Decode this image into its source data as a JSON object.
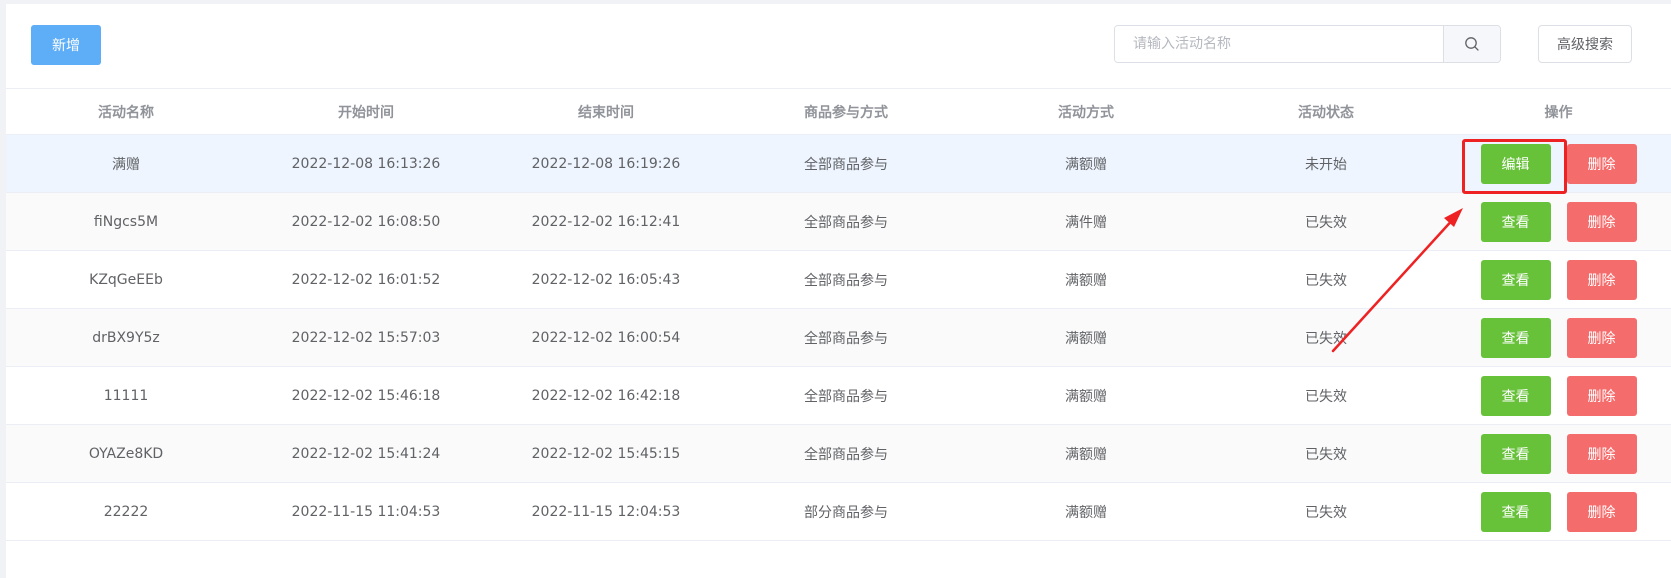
{
  "toolbar": {
    "add_label": "新增",
    "search_placeholder": "请输入活动名称",
    "search_value": "",
    "advanced_label": "高级搜索"
  },
  "table": {
    "columns": [
      "活动名称",
      "开始时间",
      "结束时间",
      "商品参与方式",
      "活动方式",
      "活动状态",
      "操作"
    ],
    "rows": [
      {
        "name": "满赠",
        "start": "2022-12-08 16:13:26",
        "end": "2022-12-08 16:19:26",
        "scope": "全部商品参与",
        "mode": "满额赠",
        "status": "未开始",
        "primary_action": "编辑",
        "delete_action": "删除"
      },
      {
        "name": "fiNgcs5M",
        "start": "2022-12-02 16:08:50",
        "end": "2022-12-02 16:12:41",
        "scope": "全部商品参与",
        "mode": "满件赠",
        "status": "已失效",
        "primary_action": "查看",
        "delete_action": "删除"
      },
      {
        "name": "KZqGeEEb",
        "start": "2022-12-02 16:01:52",
        "end": "2022-12-02 16:05:43",
        "scope": "全部商品参与",
        "mode": "满额赠",
        "status": "已失效",
        "primary_action": "查看",
        "delete_action": "删除"
      },
      {
        "name": "drBX9Y5z",
        "start": "2022-12-02 15:57:03",
        "end": "2022-12-02 16:00:54",
        "scope": "全部商品参与",
        "mode": "满额赠",
        "status": "已失效",
        "primary_action": "查看",
        "delete_action": "删除"
      },
      {
        "name": "11111",
        "start": "2022-12-02 15:46:18",
        "end": "2022-12-02 16:42:18",
        "scope": "全部商品参与",
        "mode": "满额赠",
        "status": "已失效",
        "primary_action": "查看",
        "delete_action": "删除"
      },
      {
        "name": "OYAZe8KD",
        "start": "2022-12-02 15:41:24",
        "end": "2022-12-02 15:45:15",
        "scope": "全部商品参与",
        "mode": "满额赠",
        "status": "已失效",
        "primary_action": "查看",
        "delete_action": "删除"
      },
      {
        "name": "22222",
        "start": "2022-11-15 11:04:53",
        "end": "2022-11-15 12:04:53",
        "scope": "部分商品参与",
        "mode": "满额赠",
        "status": "已失效",
        "primary_action": "查看",
        "delete_action": "删除"
      }
    ]
  },
  "colors": {
    "primary": "#5eadf7",
    "success": "#67c23a",
    "danger": "#f56c6c",
    "annotation": "#ee2222"
  },
  "icons": {
    "search": "search-icon"
  }
}
